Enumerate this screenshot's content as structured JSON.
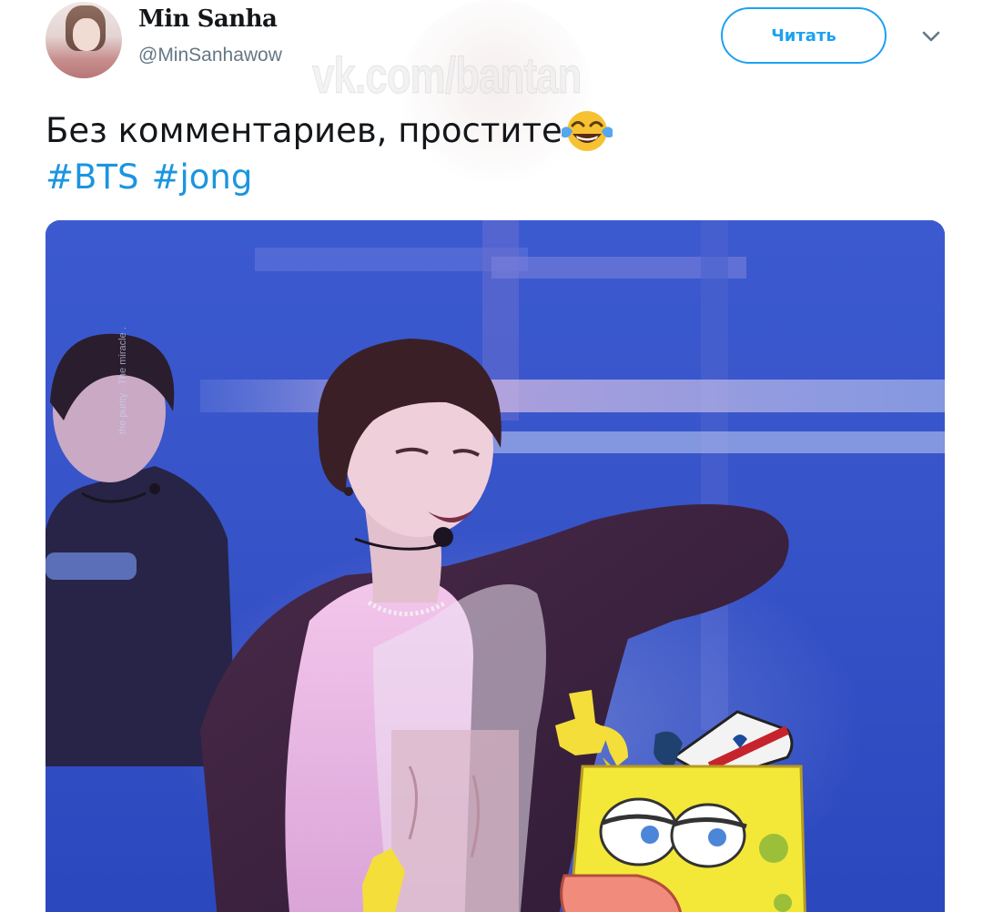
{
  "user": {
    "display_name": "Min Sanha",
    "handle": "@MinSanhawow"
  },
  "watermark": "vk.com/bantan",
  "follow_button": {
    "label": "Читать"
  },
  "tweet": {
    "text": "Без комментариев, простите",
    "emoji": "face-with-tears-of-joy",
    "hashtags": [
      "#BTS",
      "#jong"
    ]
  },
  "media": {
    "photo_caption": "the purity . The miracle .",
    "icons": [
      "chevron-down-icon",
      "spongebob-sticker",
      "face-with-tears-of-joy-emoji"
    ]
  },
  "colors": {
    "accent": "#1da1f2",
    "hashtag": "#1b95e0",
    "name": "#14171a",
    "handle": "#657786",
    "stage_blue": "#3752c8"
  }
}
